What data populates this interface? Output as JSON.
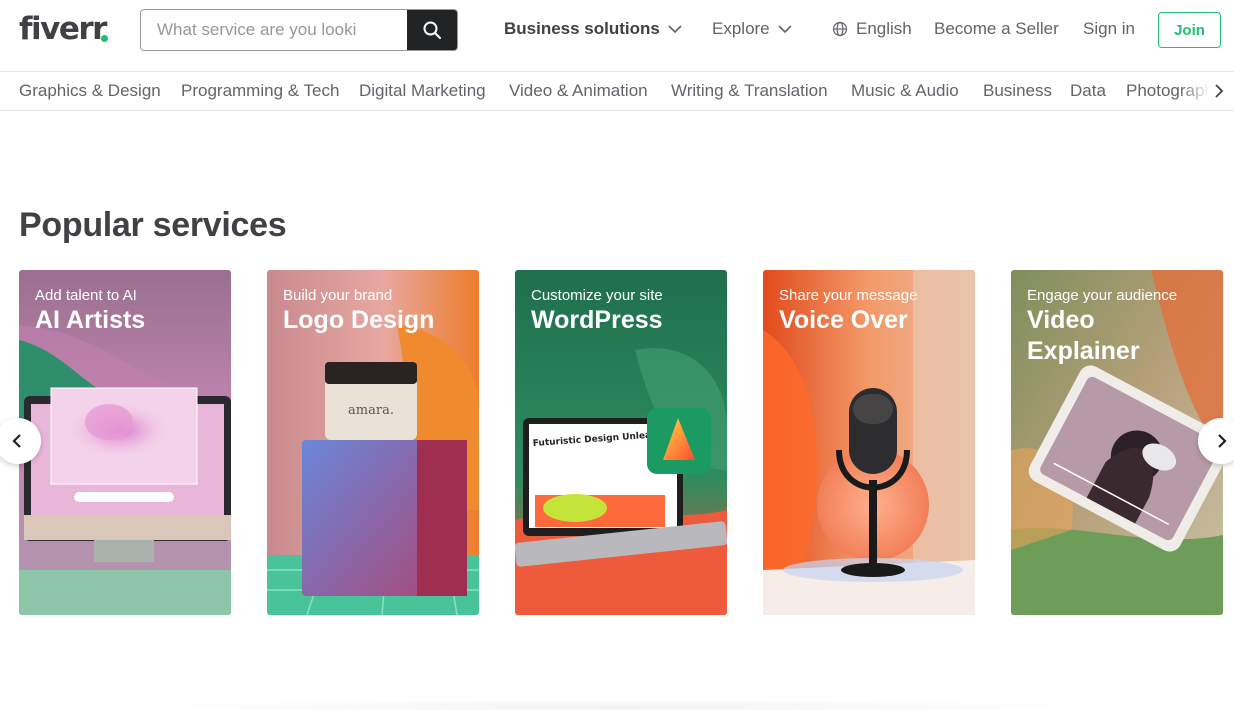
{
  "brand": {
    "name": "fiverr",
    "accent": "#1dbf73"
  },
  "search": {
    "placeholder": "What service are you looki",
    "icon": "search-icon"
  },
  "header": {
    "business": "Business solutions",
    "explore": "Explore",
    "language": "English",
    "become_seller": "Become a Seller",
    "sign_in": "Sign in",
    "join": "Join"
  },
  "categories": [
    "Graphics & Design",
    "Programming & Tech",
    "Digital Marketing",
    "Video & Animation",
    "Writing & Translation",
    "Music & Audio",
    "Business",
    "Data",
    "Photograph"
  ],
  "popular": {
    "title": "Popular services",
    "cards": [
      {
        "subtitle": "Add talent to AI",
        "title": "AI Artists"
      },
      {
        "subtitle": "Build your brand",
        "title": "Logo Design",
        "image_text": "amara."
      },
      {
        "subtitle": "Customize your site",
        "title": "WordPress",
        "image_text": "Futuristic Design Unleashed"
      },
      {
        "subtitle": "Share your message",
        "title": "Voice Over"
      },
      {
        "subtitle": "Engage your audience",
        "title": "Video Explainer"
      }
    ]
  }
}
